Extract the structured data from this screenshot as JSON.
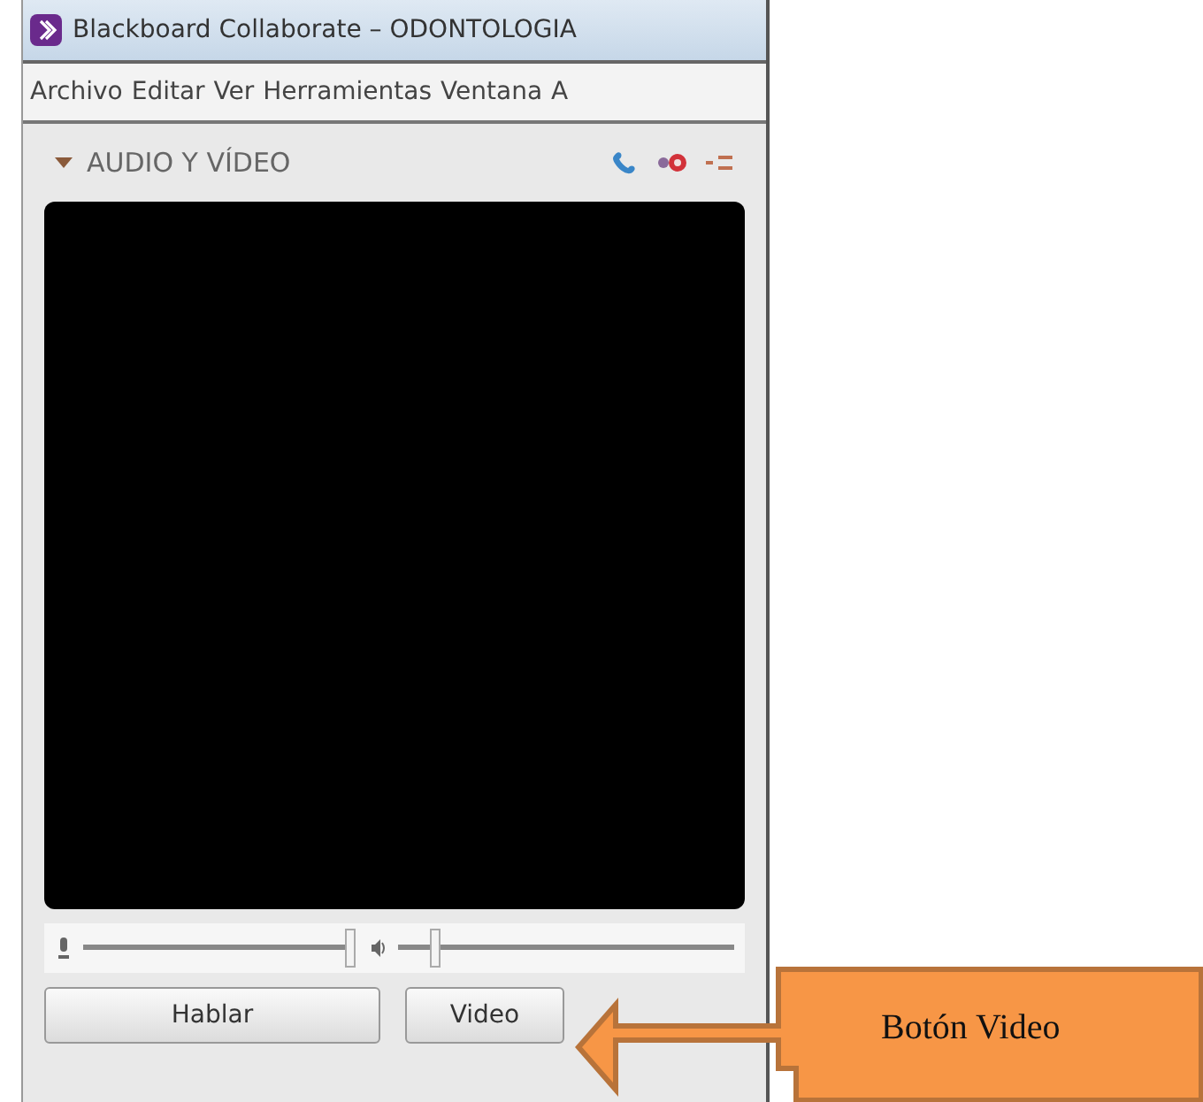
{
  "window": {
    "title": "Blackboard Collaborate – ODONTOLOGIA"
  },
  "menu": [
    "Archivo",
    "Editar",
    "Ver",
    "Herramientas",
    "Ventana",
    "A"
  ],
  "panel": {
    "title": "AUDIO Y VÍDEO",
    "expanded": true
  },
  "sliders": [
    {
      "kind": "microphone",
      "level": 1
    },
    {
      "kind": "speaker",
      "level": 0.1
    }
  ],
  "buttons": [
    "Hablar",
    "Video"
  ],
  "callout": {
    "label": "Botón Video"
  }
}
